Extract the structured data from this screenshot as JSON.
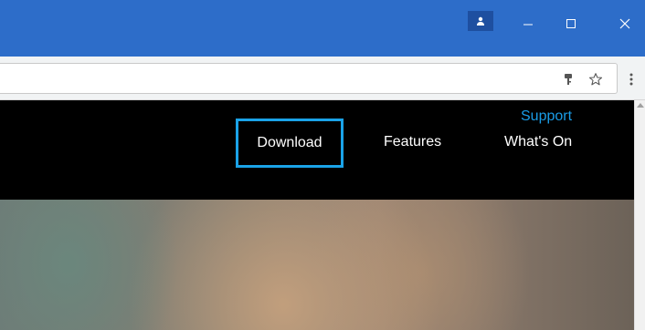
{
  "browser": {
    "icons": {
      "profile": "person-icon",
      "minimize": "minimize-icon",
      "maximize": "maximize-icon",
      "close": "close-icon",
      "key": "key-icon",
      "star": "star-icon",
      "menu": "three-dot-menu-icon"
    },
    "colors": {
      "titlebar": "#2d6dc9",
      "accent": "#1aa3e8"
    }
  },
  "site_nav": {
    "support": "Support",
    "items": [
      {
        "label": "Download"
      },
      {
        "label": "Features"
      },
      {
        "label": "What's On"
      }
    ]
  }
}
